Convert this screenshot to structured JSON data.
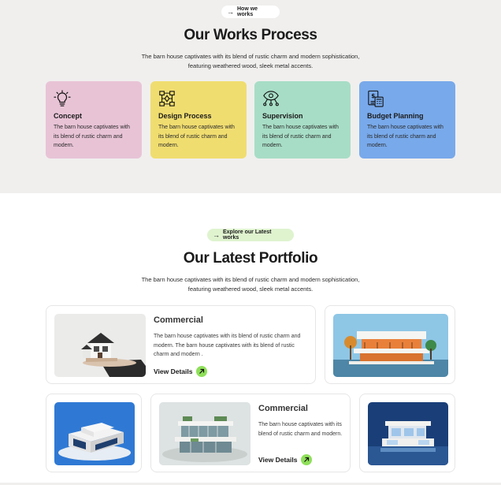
{
  "works": {
    "pill_label": "How we works",
    "title": "Our Works Process",
    "subtitle_line1": "The barn house captivates with its blend of rustic charm and modern sophistication,",
    "subtitle_line2": "featuring weathered wood, sleek metal accents.",
    "steps": [
      {
        "title": "Concept",
        "icon": "lightbulb-icon",
        "color": "#e8c3d6",
        "desc": "The barn house captivates with its blend of rustic charm and modern."
      },
      {
        "title": "Design Process",
        "icon": "flowchart-icon",
        "color": "#f0dd70",
        "desc": "The barn house captivates with its blend of rustic charm and modern."
      },
      {
        "title": "Supervision",
        "icon": "eye-network-icon",
        "color": "#a7ddc6",
        "desc": "The barn house captivates with its blend of rustic charm and modern."
      },
      {
        "title": "Budget Planning",
        "icon": "budget-calculator-icon",
        "color": "#78a9ea",
        "desc": "The barn house captivates with its blend of rustic charm and modern."
      }
    ]
  },
  "portfolio": {
    "pill_label": "Explore our Latest works",
    "title": "Our Latest Portfolio",
    "subtitle_line1": "The barn house captivates with its blend of rustic charm and modern sophistication,",
    "subtitle_line2": "featuring weathered wood, sleek metal accents.",
    "featured_1": {
      "title": "Commercial",
      "desc": "The barn house captivates with its blend of rustic charm and modern. The barn house captivates with its blend of rustic charm and modern .",
      "link": "View Details"
    },
    "featured_2": {
      "title": "Commercial",
      "desc": "The barn house captivates with its blend of rustic charm and modern.",
      "link": "View Details"
    }
  },
  "colors": {
    "accent_green": "#8fe05a",
    "section_bg": "#f0efee"
  }
}
